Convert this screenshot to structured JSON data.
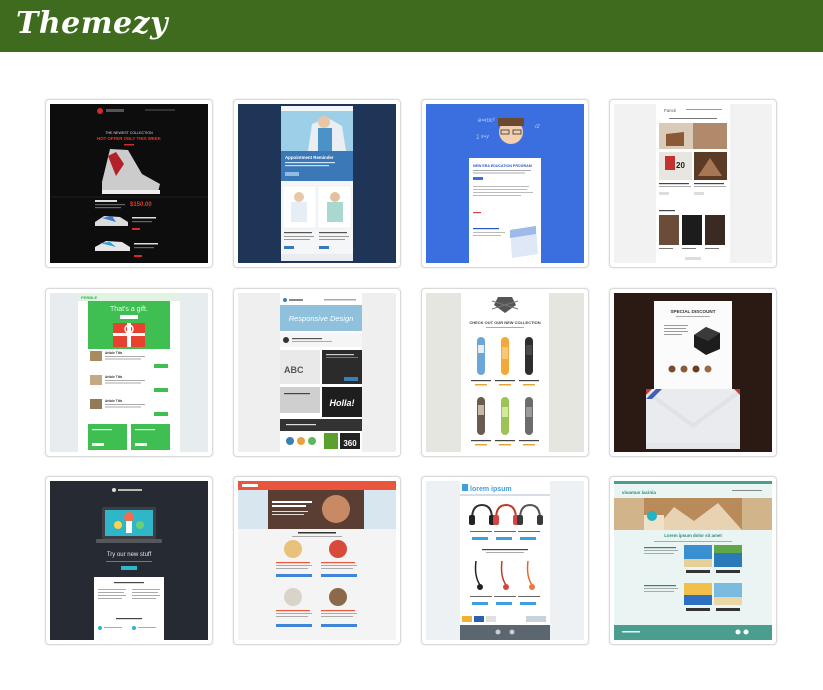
{
  "header": {
    "logo_text": "Themezy",
    "bg_color": "#3e6b1e"
  },
  "templates": [
    {
      "name": "sneaker-collection",
      "title": "THE NEWEST COLLECTION",
      "headline": "HOT OFFER ONLY THIS WEEK",
      "price": "$150.00"
    },
    {
      "name": "appointment-reminder",
      "title": "Appointment Reminder"
    },
    {
      "name": "education-program",
      "title": "NEW ERA EDUCATION PROGRAM"
    },
    {
      "name": "furniture-shop",
      "brand": "Fancé"
    },
    {
      "name": "gift-newsletter",
      "brand": "PEBBLE",
      "headline": "That's a gift.",
      "items": [
        "Article Title",
        "Article Title",
        "Article Title"
      ]
    },
    {
      "name": "responsive-design",
      "headline": "Responsive Design",
      "badge": "Holla!"
    },
    {
      "name": "skateboard-collection",
      "headline": "CHECK OUT OUR NEW COLLECTION"
    },
    {
      "name": "special-discount",
      "headline": "SPECIAL DISCOUNT"
    },
    {
      "name": "new-stuff",
      "headline": "Try our new stuff"
    },
    {
      "name": "photo-blog"
    },
    {
      "name": "headphones-shop",
      "brand": "lorem ipsum"
    },
    {
      "name": "travel-agency",
      "brand": "vivamus lacinia",
      "headline": "Lorem ipsum dolor sit amet"
    }
  ]
}
